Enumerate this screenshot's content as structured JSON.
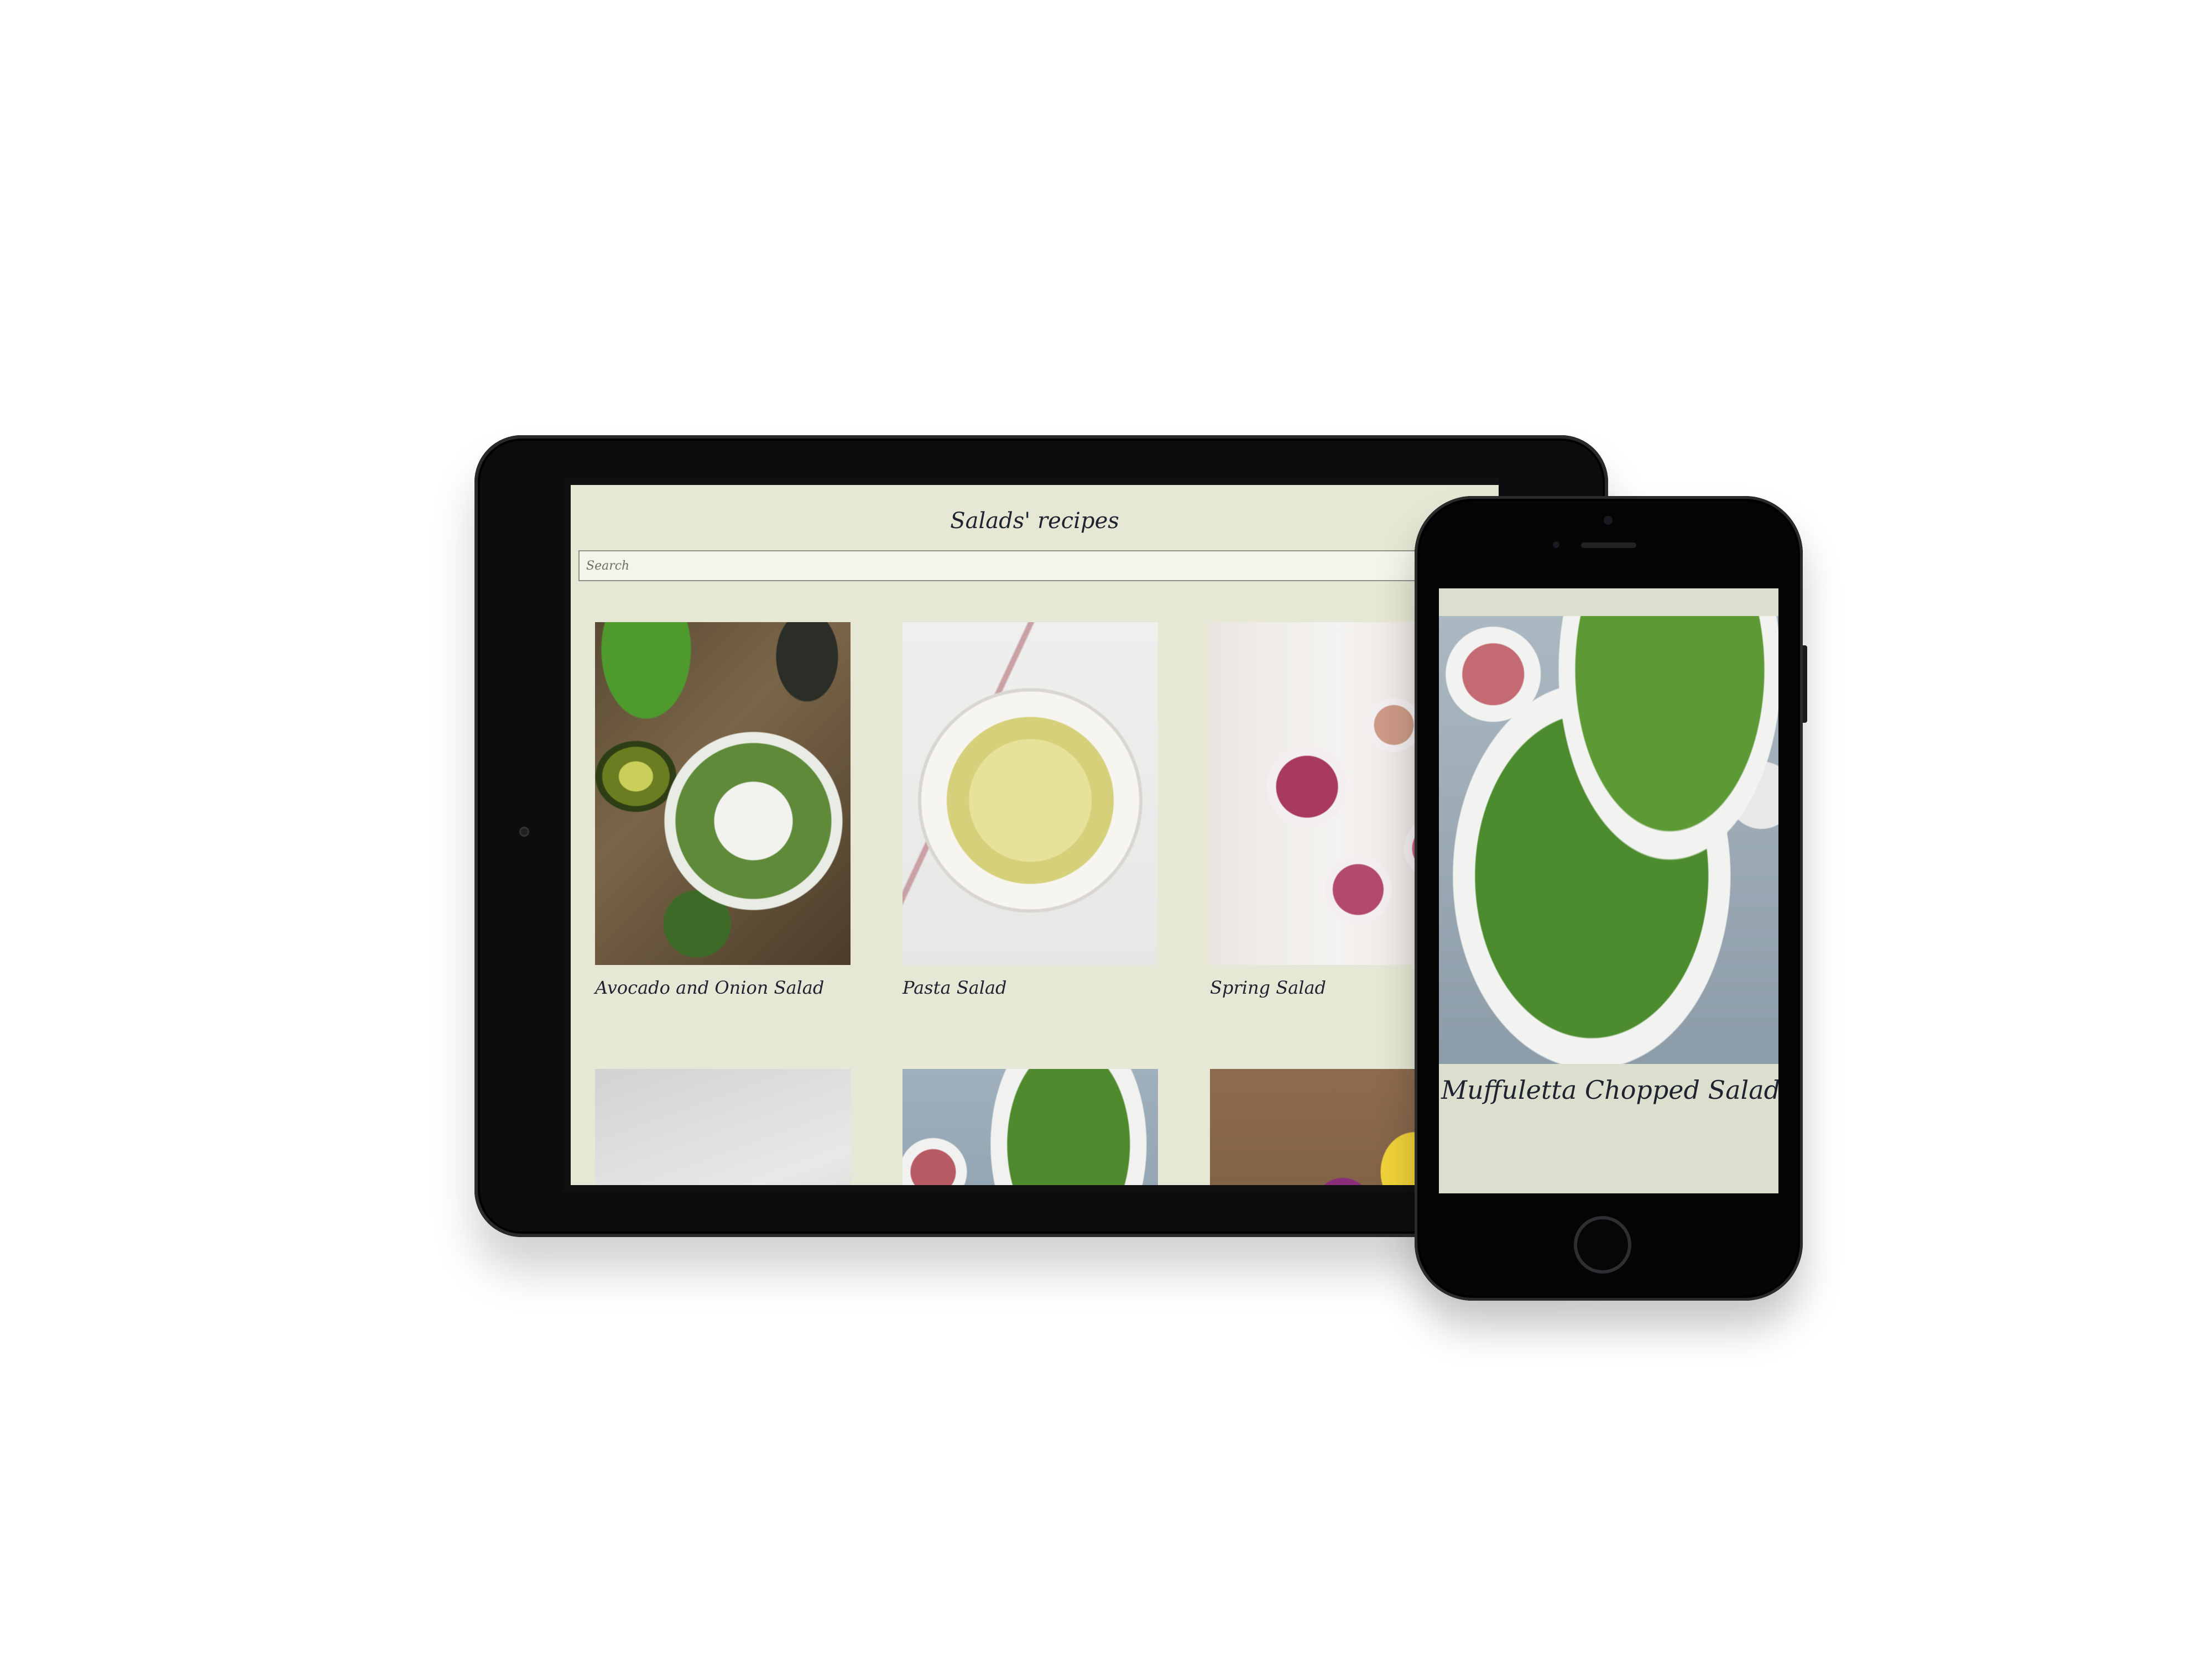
{
  "tablet": {
    "app_title": "Salads' recipes",
    "search": {
      "placeholder": "Search",
      "value": ""
    },
    "cards": [
      {
        "title": "Avocado and Onion Salad",
        "image": "avocado-salad-photo"
      },
      {
        "title": "Pasta Salad",
        "image": "pasta-salad-photo"
      },
      {
        "title": "Spring Salad",
        "image": "spring-salad-photo"
      },
      {
        "title": "",
        "image": "grapefruit-salad-photo"
      },
      {
        "title": "",
        "image": "muffuletta-salad-photo"
      },
      {
        "title": "",
        "image": "vegetable-salad-photo"
      }
    ]
  },
  "phone": {
    "card": {
      "title": "Muffuletta Chopped Salad",
      "image": "muffuletta-salad-photo"
    }
  },
  "colors": {
    "app_background": "#e6e7d4",
    "text": "#1e2330",
    "device_frame": "#0d0d0d"
  }
}
